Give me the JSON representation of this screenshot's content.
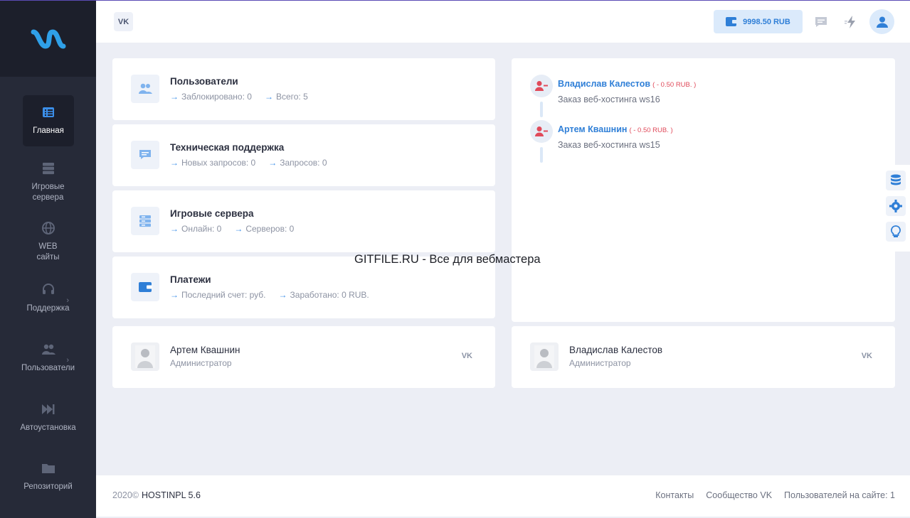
{
  "sidebar": {
    "logo": "hostinpl-logo",
    "items": [
      {
        "label": "Главная",
        "icon": "list-icon"
      },
      {
        "label": "Игровые сервера",
        "icon": "server-icon"
      },
      {
        "label": "WEB сайты",
        "icon": "globe-icon"
      },
      {
        "label": "Поддержка",
        "icon": "headset-icon"
      },
      {
        "label": "Пользователи",
        "icon": "users-icon"
      },
      {
        "label": "Автоустановка",
        "icon": "fast-forward-icon"
      },
      {
        "label": "Репозиторий",
        "icon": "folder-icon"
      }
    ]
  },
  "header": {
    "vk_label": "VK",
    "balance": "9998.50 RUB"
  },
  "stats": [
    {
      "title": "Пользователи",
      "a": "Заблокировано: 0",
      "b": "Всего: 5",
      "icon": "users-icon"
    },
    {
      "title": "Техническая поддержка",
      "a": "Новых запросов: 0",
      "b": "Запросов: 0",
      "icon": "chat-icon"
    },
    {
      "title": "Игровые сервера",
      "a": "Онлайн: 0",
      "b": "Серверов: 0",
      "icon": "server-icon"
    },
    {
      "title": "Платежи",
      "a": "Последний счет: руб.",
      "b": "Заработано: 0 RUB.",
      "icon": "wallet-icon"
    }
  ],
  "activity": [
    {
      "name": "Владислав Калестов",
      "amount": "( - 0.50 RUB. )",
      "desc": "Заказ веб-хостинга ws16"
    },
    {
      "name": "Артем Квашнин",
      "amount": "( - 0.50 RUB. )",
      "desc": "Заказ веб-хостинга ws15"
    }
  ],
  "admins": [
    {
      "name": "Артем Квашнин",
      "role": "Администратор"
    },
    {
      "name": "Владислав Калестов",
      "role": "Администратор"
    }
  ],
  "watermark": "GITFILE.RU - Все для вебмастера",
  "footer": {
    "year": "2020©",
    "brand": "HOSTINPL 5.6",
    "links": [
      "Контакты",
      "Сообщество VK",
      "Пользователей на сайте: 1"
    ]
  },
  "colors": {
    "accent": "#2f7fd7",
    "sidebar": "#262a38",
    "danger": "#e04a5a"
  }
}
